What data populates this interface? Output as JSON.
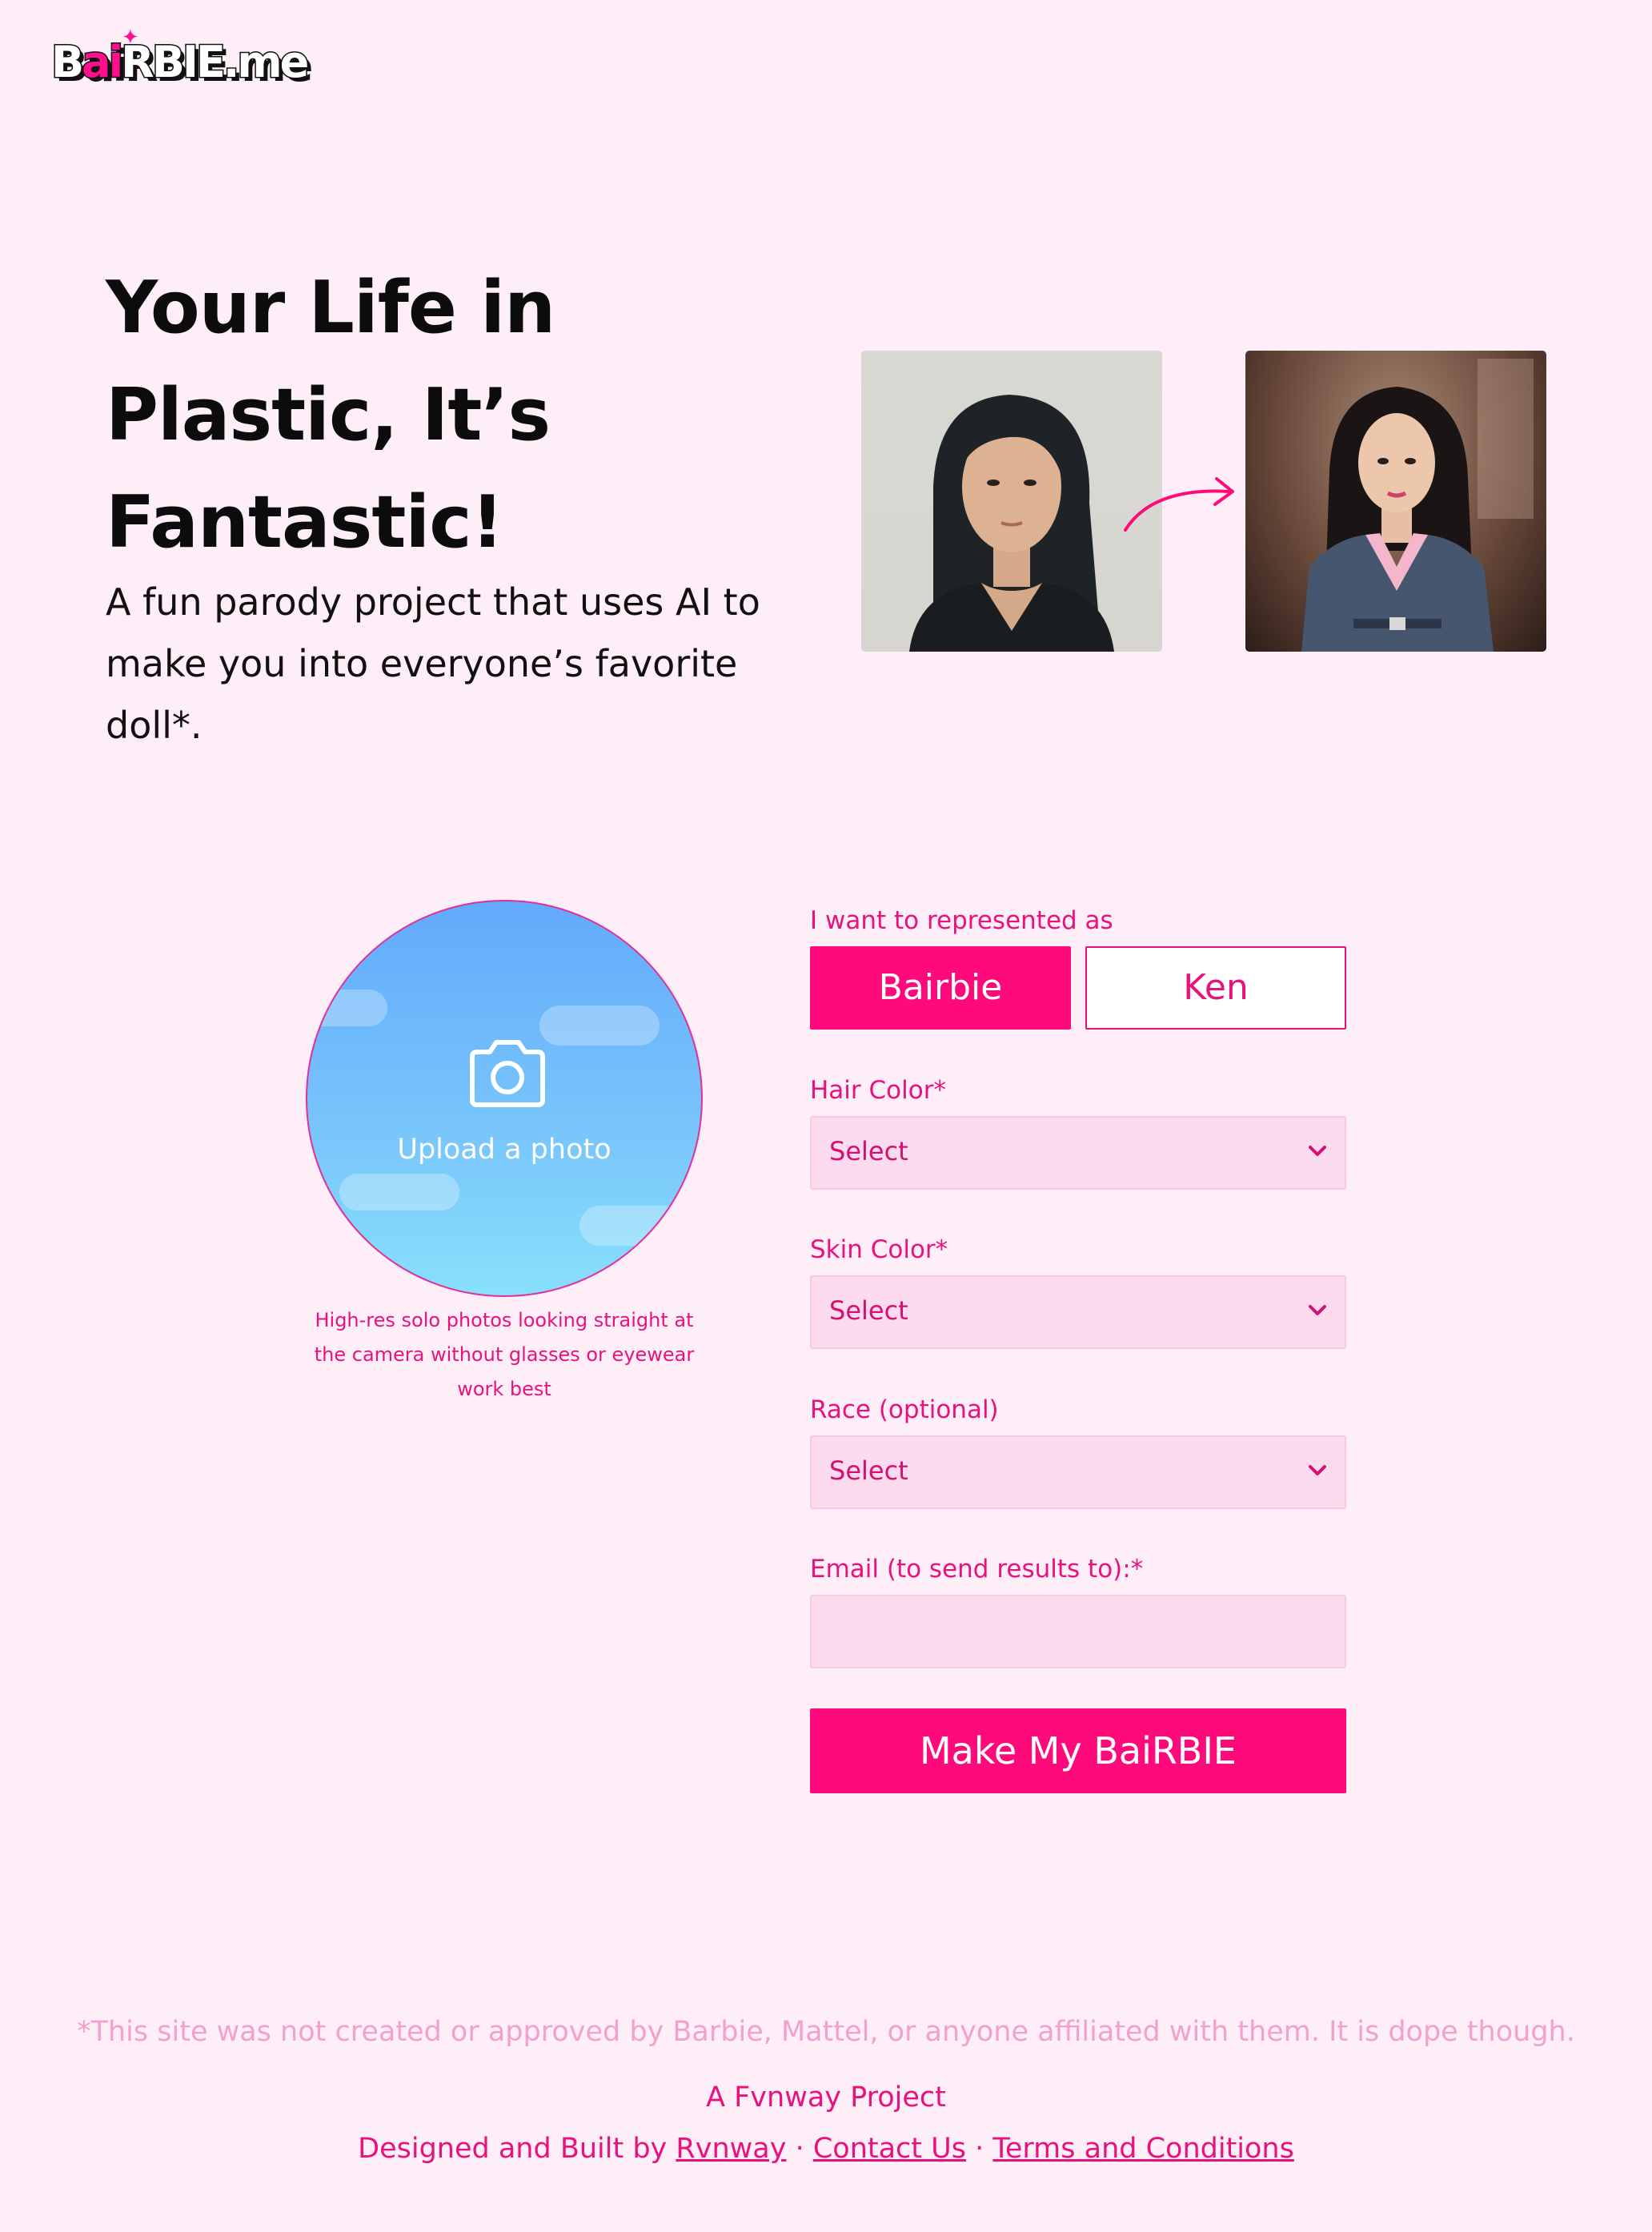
{
  "logo": {
    "text_b": "B",
    "text_ai": "ai",
    "text_rest": "RBIE.me"
  },
  "hero": {
    "title": "Your Life in Plastic, It’s Fantastic!",
    "subtitle": "A fun parody project that uses AI to make you into everyone’s favorite doll*."
  },
  "upload": {
    "label": "Upload a photo",
    "hint": "High-res solo photos looking straight at the camera without glasses or eyewear work best"
  },
  "form": {
    "represent_label": "I want to represented as",
    "options": [
      "Bairbie",
      "Ken"
    ],
    "selected_option": "Bairbie",
    "hair_label": "Hair Color*",
    "hair_value": "Select",
    "skin_label": "Skin Color*",
    "skin_value": "Select",
    "race_label": "Race (optional)",
    "race_value": "Select",
    "email_label": "Email (to send results to):*",
    "email_value": "",
    "submit_label": "Make My BaiRBIE"
  },
  "footer": {
    "disclaimer": "*This site was not created or approved by Barbie, Mattel, or anyone affiliated with them. It is dope though.",
    "project": "A Fvnway Project",
    "designed_prefix": "Designed and Built by",
    "designer_link": "Rvnway",
    "separator": "·",
    "contact_link": "Contact Us",
    "terms_link": "Terms and Conditions"
  },
  "colors": {
    "accent": "#ff0a7a",
    "background": "#fdeef8",
    "field": "#fddbef"
  }
}
